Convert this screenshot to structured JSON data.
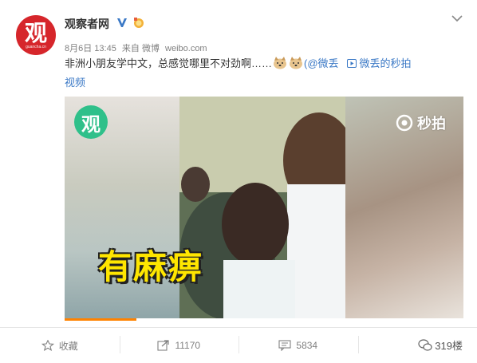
{
  "account": {
    "avatar_glyph": "观",
    "avatar_caption": "guancha.cn",
    "name": "观察者网"
  },
  "post": {
    "date": "8月6日 13:45",
    "via": "来自 微博",
    "source": "weibo.com",
    "text": "非洲小朋友学中文，总感觉哪里不对劲啊……",
    "emoji_names": [
      "doge-emoji",
      "doge-emoji"
    ],
    "mention": "(@微丢",
    "video_link": "微丢的秒拍",
    "video_link_cont": "视频"
  },
  "video": {
    "corner_logo": "观",
    "watermark": "秒拍",
    "subtitle": "有麻痹",
    "progress_fraction": 0.18,
    "accent_color": "#ff8200"
  },
  "actions": {
    "favorite": "收藏",
    "repost": "11170",
    "comment": "5834"
  },
  "watermark": "319楼",
  "colors": {
    "link": "#3b79c6",
    "avatar_bg": "#d6262b",
    "subtitle": "#ffe600"
  }
}
